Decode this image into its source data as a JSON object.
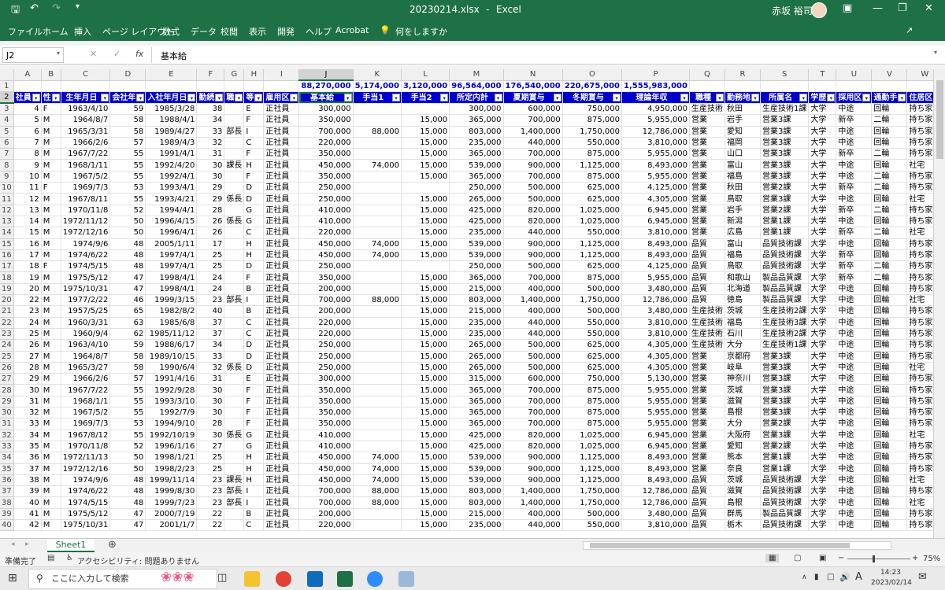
{
  "app": {
    "file_name": "20230214.xlsx",
    "separator": "-",
    "app_name": "Excel",
    "user": "赤坂 裕司"
  },
  "menu": [
    "ファイル",
    "ホーム",
    "挿入",
    "ページ レイアウト",
    "数式",
    "データ",
    "校閲",
    "表示",
    "開発",
    "ヘルプ",
    "Acrobat"
  ],
  "tell_me": "何をしますか",
  "formula_bar": {
    "name_box": "J2",
    "fx": "fx",
    "value": "基本給"
  },
  "columns": [
    "A",
    "B",
    "C",
    "D",
    "E",
    "F",
    "G",
    "H",
    "I",
    "J",
    "K",
    "L",
    "M",
    "N",
    "O",
    "P",
    "Q",
    "R",
    "S",
    "T",
    "U",
    "V",
    "W"
  ],
  "totals": {
    "J": "88,270,000",
    "K": "5,174,000",
    "L": "3,120,000",
    "M": "96,564,000",
    "N": "176,540,000",
    "O": "220,675,000",
    "P": "1,555,983,000"
  },
  "headers": [
    "社員",
    "性",
    "生年月日",
    "会社年",
    "入社年月日",
    "勤続",
    "職",
    "等",
    "雇用区",
    "基本給",
    "手当1",
    "手当2",
    "所定内計",
    "夏期賞与",
    "冬期賞与",
    "理論年収",
    "職種",
    "勤務地",
    "所属名",
    "学歴",
    "採用区",
    "通勤手",
    "住居区"
  ],
  "rows": [
    [
      "4",
      "F",
      "1963/4/10",
      "59",
      "1985/3/28",
      "38",
      "",
      "E",
      "正社員",
      "300,000",
      "",
      "",
      "300,000",
      "600,000",
      "750,000",
      "4,950,000",
      "生産技術",
      "秋田",
      "生産技術1課",
      "大学",
      "中途",
      "回輪",
      "持ち家"
    ],
    [
      "5",
      "M",
      "1964/8/7",
      "58",
      "1988/4/1",
      "34",
      "",
      "F",
      "正社員",
      "350,000",
      "",
      "15,000",
      "365,000",
      "700,000",
      "875,000",
      "5,955,000",
      "営業",
      "岩手",
      "営業3課",
      "大学",
      "新卒",
      "二輪",
      "持ち家"
    ],
    [
      "6",
      "M",
      "1965/3/31",
      "58",
      "1989/4/27",
      "33",
      "部長",
      "I",
      "正社員",
      "700,000",
      "88,000",
      "15,000",
      "803,000",
      "1,400,000",
      "1,750,000",
      "12,786,000",
      "営業",
      "愛知",
      "営業3課",
      "大学",
      "中途",
      "回輪",
      "持ち家"
    ],
    [
      "7",
      "M",
      "1966/2/6",
      "57",
      "1989/4/3",
      "32",
      "",
      "C",
      "正社員",
      "220,000",
      "",
      "15,000",
      "235,000",
      "440,000",
      "550,000",
      "3,810,000",
      "営業",
      "福岡",
      "営業3課",
      "大学",
      "中途",
      "回輪",
      "持ち家"
    ],
    [
      "8",
      "M",
      "1967/7/22",
      "55",
      "1991/4/1",
      "31",
      "",
      "F",
      "正社員",
      "350,000",
      "",
      "15,000",
      "365,000",
      "700,000",
      "875,000",
      "5,955,000",
      "営業",
      "山口",
      "営業3課",
      "大学",
      "新卒",
      "二輪",
      "持ち家"
    ],
    [
      "9",
      "M",
      "1968/1/11",
      "55",
      "1992/4/20",
      "30",
      "課長",
      "H",
      "正社員",
      "450,000",
      "74,000",
      "15,000",
      "539,000",
      "900,000",
      "1,125,000",
      "8,493,000",
      "営業",
      "富山",
      "営業3課",
      "大学",
      "中途",
      "回輪",
      "社宅"
    ],
    [
      "10",
      "M",
      "1967/5/2",
      "55",
      "1992/4/1",
      "30",
      "",
      "F",
      "正社員",
      "350,000",
      "",
      "15,000",
      "365,000",
      "700,000",
      "875,000",
      "5,955,000",
      "営業",
      "福島",
      "営業3課",
      "大学",
      "中途",
      "二輪",
      "持ち家"
    ],
    [
      "11",
      "F",
      "1969/7/3",
      "53",
      "1993/4/1",
      "29",
      "",
      "D",
      "正社員",
      "250,000",
      "",
      "",
      "250,000",
      "500,000",
      "625,000",
      "4,125,000",
      "営業",
      "秋田",
      "営業2課",
      "大学",
      "新卒",
      "二輪",
      "持ち家"
    ],
    [
      "12",
      "M",
      "1967/8/11",
      "55",
      "1993/4/21",
      "29",
      "係長",
      "D",
      "正社員",
      "250,000",
      "",
      "15,000",
      "265,000",
      "500,000",
      "625,000",
      "4,305,000",
      "営業",
      "鳥取",
      "営業3課",
      "大学",
      "中途",
      "回輪",
      "社宅"
    ],
    [
      "13",
      "M",
      "1970/11/8",
      "52",
      "1994/4/1",
      "28",
      "",
      "G",
      "正社員",
      "410,000",
      "",
      "15,000",
      "425,000",
      "820,000",
      "1,025,000",
      "6,945,000",
      "営業",
      "岩手",
      "営業2課",
      "大学",
      "新卒",
      "二輪",
      "持ち家"
    ],
    [
      "14",
      "M",
      "1972/11/12",
      "50",
      "1996/4/15",
      "26",
      "係長",
      "G",
      "正社員",
      "410,000",
      "",
      "15,000",
      "425,000",
      "820,000",
      "1,025,000",
      "6,945,000",
      "営業",
      "新潟",
      "営業1課",
      "大学",
      "中途",
      "回輪",
      "持ち家"
    ],
    [
      "15",
      "M",
      "1972/12/16",
      "50",
      "1996/4/1",
      "26",
      "",
      "C",
      "正社員",
      "220,000",
      "",
      "15,000",
      "235,000",
      "440,000",
      "550,000",
      "3,810,000",
      "営業",
      "広島",
      "営業1課",
      "大学",
      "新卒",
      "二輪",
      "社宅"
    ],
    [
      "16",
      "M",
      "1974/9/6",
      "48",
      "2005/1/11",
      "17",
      "",
      "H",
      "正社員",
      "450,000",
      "74,000",
      "15,000",
      "539,000",
      "900,000",
      "1,125,000",
      "8,493,000",
      "品質",
      "富山",
      "品質技術課",
      "大学",
      "中途",
      "回輪",
      "持ち家"
    ],
    [
      "17",
      "M",
      "1974/6/22",
      "48",
      "1997/4/1",
      "25",
      "",
      "H",
      "正社員",
      "450,000",
      "74,000",
      "15,000",
      "539,000",
      "900,000",
      "1,125,000",
      "8,493,000",
      "品質",
      "福島",
      "品質技術課",
      "大学",
      "新卒",
      "回輪",
      "持ち家"
    ],
    [
      "18",
      "F",
      "1974/5/15",
      "48",
      "1997/4/1",
      "25",
      "",
      "D",
      "正社員",
      "250,000",
      "",
      "",
      "250,000",
      "500,000",
      "625,000",
      "4,125,000",
      "品質",
      "鳥取",
      "品質技術課",
      "大学",
      "新卒",
      "二輪",
      "持ち家"
    ],
    [
      "19",
      "M",
      "1975/5/12",
      "47",
      "1998/4/1",
      "24",
      "",
      "F",
      "正社員",
      "350,000",
      "",
      "15,000",
      "365,000",
      "700,000",
      "875,000",
      "5,955,000",
      "品質",
      "和歌山",
      "製品品質課",
      "大学",
      "新卒",
      "二輪",
      "持ち家"
    ],
    [
      "20",
      "M",
      "1975/10/31",
      "47",
      "1998/4/1",
      "24",
      "",
      "B",
      "正社員",
      "200,000",
      "",
      "15,000",
      "215,000",
      "400,000",
      "500,000",
      "3,480,000",
      "品質",
      "北海道",
      "製品品質課",
      "大学",
      "中途",
      "回輪",
      "持ち家"
    ],
    [
      "22",
      "M",
      "1977/2/22",
      "46",
      "1999/3/15",
      "23",
      "部長",
      "I",
      "正社員",
      "700,000",
      "88,000",
      "15,000",
      "803,000",
      "1,400,000",
      "1,750,000",
      "12,786,000",
      "品質",
      "徳島",
      "製品品質課",
      "大学",
      "中途",
      "回輪",
      "社宅"
    ],
    [
      "23",
      "M",
      "1957/5/25",
      "65",
      "1982/8/2",
      "40",
      "",
      "B",
      "正社員",
      "200,000",
      "",
      "15,000",
      "215,000",
      "400,000",
      "500,000",
      "3,480,000",
      "生産技術",
      "茨城",
      "生産技術2課",
      "大学",
      "中途",
      "回輪",
      "持ち家"
    ],
    [
      "24",
      "M",
      "1960/3/31",
      "63",
      "1985/6/8",
      "37",
      "",
      "C",
      "正社員",
      "220,000",
      "",
      "15,000",
      "235,000",
      "440,000",
      "550,000",
      "3,810,000",
      "生産技術",
      "福島",
      "生産技術3課",
      "大学",
      "中途",
      "回輪",
      "持ち家"
    ],
    [
      "25",
      "M",
      "1960/9/4",
      "62",
      "1985/11/12",
      "37",
      "",
      "C",
      "正社員",
      "220,000",
      "",
      "15,000",
      "235,000",
      "440,000",
      "550,000",
      "3,810,000",
      "生産技術",
      "石川",
      "生産技術2課",
      "大学",
      "中途",
      "回輪",
      "持ち家"
    ],
    [
      "26",
      "M",
      "1963/4/10",
      "59",
      "1988/6/17",
      "34",
      "",
      "D",
      "正社員",
      "250,000",
      "",
      "15,000",
      "265,000",
      "500,000",
      "625,000",
      "4,305,000",
      "生産技術",
      "大分",
      "生産技術1課",
      "大学",
      "中途",
      "回輪",
      "持ち家"
    ],
    [
      "27",
      "M",
      "1964/8/7",
      "58",
      "1989/10/15",
      "33",
      "",
      "D",
      "正社員",
      "250,000",
      "",
      "15,000",
      "265,000",
      "500,000",
      "625,000",
      "4,305,000",
      "営業",
      "京都府",
      "営業3課",
      "大学",
      "中途",
      "回輪",
      "持ち家"
    ],
    [
      "28",
      "M",
      "1965/3/27",
      "58",
      "1990/6/4",
      "32",
      "係長",
      "D",
      "正社員",
      "250,000",
      "",
      "15,000",
      "265,000",
      "500,000",
      "625,000",
      "4,305,000",
      "営業",
      "岐阜",
      "営業3課",
      "大学",
      "中途",
      "回輪",
      "社宅"
    ],
    [
      "29",
      "M",
      "1966/2/6",
      "57",
      "1991/4/16",
      "31",
      "",
      "E",
      "正社員",
      "300,000",
      "",
      "15,000",
      "315,000",
      "600,000",
      "750,000",
      "5,130,000",
      "営業",
      "神奈川",
      "営業3課",
      "大学",
      "中途",
      "回輪",
      "持ち家"
    ],
    [
      "30",
      "M",
      "1967/7/22",
      "55",
      "1992/9/28",
      "30",
      "",
      "F",
      "正社員",
      "350,000",
      "",
      "15,000",
      "365,000",
      "700,000",
      "875,000",
      "5,955,000",
      "営業",
      "茨城",
      "営業3課",
      "大学",
      "中途",
      "回輪",
      "持ち家"
    ],
    [
      "31",
      "M",
      "1968/1/1",
      "55",
      "1993/3/10",
      "30",
      "",
      "F",
      "正社員",
      "350,000",
      "",
      "15,000",
      "365,000",
      "700,000",
      "875,000",
      "5,955,000",
      "営業",
      "滋賀",
      "営業3課",
      "大学",
      "中途",
      "回輪",
      "持ち家"
    ],
    [
      "32",
      "M",
      "1967/5/2",
      "55",
      "1992/7/9",
      "30",
      "",
      "F",
      "正社員",
      "350,000",
      "",
      "15,000",
      "365,000",
      "700,000",
      "875,000",
      "5,955,000",
      "営業",
      "島根",
      "営業3課",
      "大学",
      "中途",
      "回輪",
      "持ち家"
    ],
    [
      "33",
      "M",
      "1969/7/3",
      "53",
      "1994/9/10",
      "28",
      "",
      "F",
      "正社員",
      "350,000",
      "",
      "15,000",
      "365,000",
      "700,000",
      "875,000",
      "5,955,000",
      "営業",
      "大分",
      "営業2課",
      "大学",
      "中途",
      "回輪",
      "持ち家"
    ],
    [
      "34",
      "M",
      "1967/8/12",
      "55",
      "1992/10/19",
      "30",
      "係長",
      "G",
      "正社員",
      "410,000",
      "",
      "15,000",
      "425,000",
      "820,000",
      "1,025,000",
      "6,945,000",
      "営業",
      "大阪府",
      "営業3課",
      "大学",
      "中途",
      "回輪",
      "社宅"
    ],
    [
      "35",
      "M",
      "1970/11/8",
      "52",
      "1996/1/16",
      "27",
      "",
      "G",
      "正社員",
      "410,000",
      "",
      "15,000",
      "425,000",
      "820,000",
      "1,025,000",
      "6,945,000",
      "営業",
      "愛知",
      "営業2課",
      "大学",
      "中途",
      "回輪",
      "持ち家"
    ],
    [
      "36",
      "M",
      "1972/11/13",
      "50",
      "1998/1/21",
      "25",
      "",
      "H",
      "正社員",
      "450,000",
      "74,000",
      "15,000",
      "539,000",
      "900,000",
      "1,125,000",
      "8,493,000",
      "営業",
      "熊本",
      "営業1課",
      "大学",
      "中途",
      "回輪",
      "持ち家"
    ],
    [
      "37",
      "M",
      "1972/12/16",
      "50",
      "1998/2/23",
      "25",
      "",
      "H",
      "正社員",
      "450,000",
      "74,000",
      "15,000",
      "539,000",
      "900,000",
      "1,125,000",
      "8,493,000",
      "営業",
      "奈良",
      "営業1課",
      "大学",
      "中途",
      "回輪",
      "持ち家"
    ],
    [
      "38",
      "M",
      "1974/9/6",
      "48",
      "1999/11/14",
      "23",
      "課長",
      "H",
      "正社員",
      "450,000",
      "74,000",
      "15,000",
      "539,000",
      "900,000",
      "1,125,000",
      "8,493,000",
      "品質",
      "茨城",
      "品質技術課",
      "大学",
      "中途",
      "回輪",
      "社宅"
    ],
    [
      "39",
      "M",
      "1974/6/22",
      "48",
      "1999/8/30",
      "23",
      "部長",
      "I",
      "正社員",
      "700,000",
      "88,000",
      "15,000",
      "803,000",
      "1,400,000",
      "1,750,000",
      "12,786,000",
      "品質",
      "滋賀",
      "品質技術課",
      "大学",
      "中途",
      "回輪",
      "持ち家"
    ],
    [
      "40",
      "M",
      "1974/5/15",
      "48",
      "1999/7/23",
      "23",
      "部長",
      "I",
      "正社員",
      "700,000",
      "88,000",
      "15,000",
      "803,000",
      "1,400,000",
      "1,750,000",
      "12,786,000",
      "品質",
      "島根",
      "品質技術課",
      "大学",
      "中途",
      "回輪",
      "社宅"
    ],
    [
      "41",
      "M",
      "1975/5/12",
      "47",
      "2000/7/19",
      "22",
      "",
      "B",
      "正社員",
      "200,000",
      "",
      "15,000",
      "215,000",
      "400,000",
      "500,000",
      "3,480,000",
      "品質",
      "群馬",
      "製品品質課",
      "大学",
      "中途",
      "回輪",
      "持ち家"
    ],
    [
      "42",
      "M",
      "1975/10/31",
      "47",
      "2001/1/7",
      "22",
      "",
      "C",
      "正社員",
      "220,000",
      "",
      "15,000",
      "235,000",
      "440,000",
      "550,000",
      "3,810,000",
      "品質",
      "栃木",
      "品質技術課",
      "大学",
      "中途",
      "回輪",
      "持ち家"
    ]
  ],
  "sheet_tab": "Sheet1",
  "status": {
    "ready": "準備完了",
    "accessibility": "アクセシビリティ: 問題ありません",
    "zoom": "75%"
  },
  "taskbar": {
    "search_placeholder": "ここに入力して検索",
    "time": "14:23",
    "date": "2023/02/14"
  }
}
